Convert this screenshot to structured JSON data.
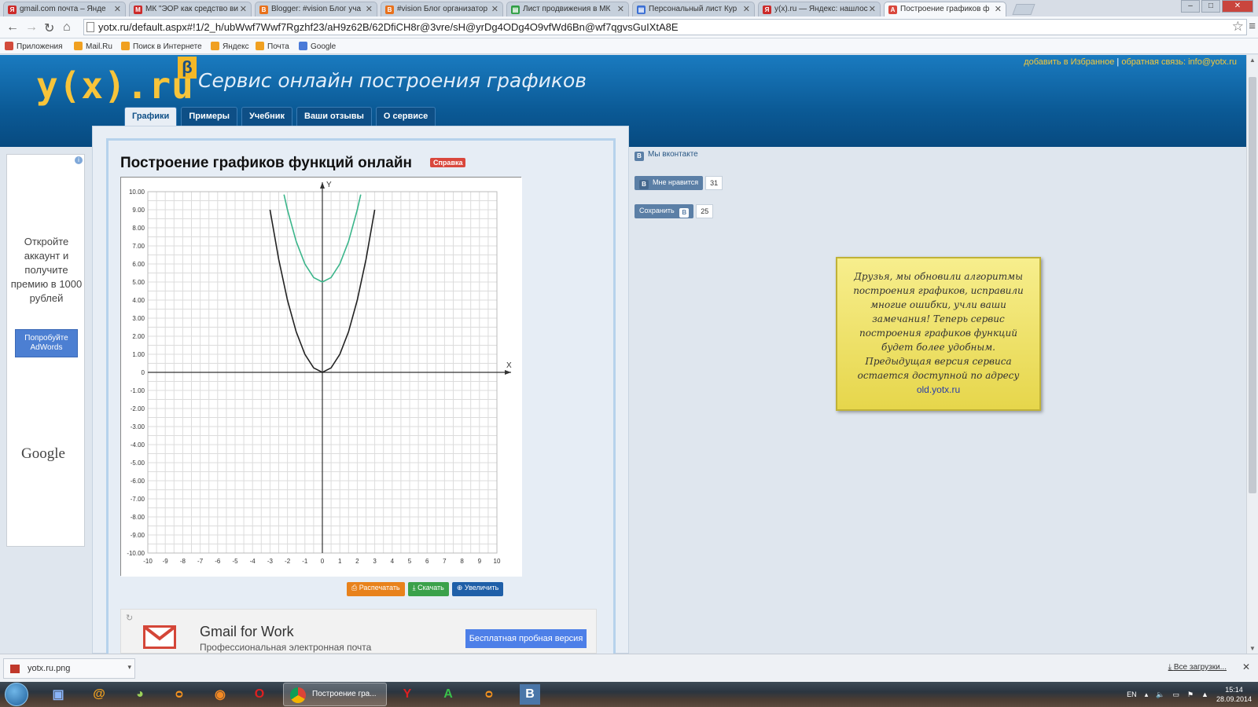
{
  "browser": {
    "tabs": [
      {
        "title": "gmail.com почта – Янде",
        "icon_color": "#cc2a2a",
        "icon": "Я"
      },
      {
        "title": "МК \"ЭОР как средство ви",
        "icon_color": "#cc2a2a",
        "icon": "M"
      },
      {
        "title": "Blogger: #vision Блог уча",
        "icon_color": "#e8711c",
        "icon": "B"
      },
      {
        "title": "#vision Блог организатор",
        "icon_color": "#e8711c",
        "icon": "B"
      },
      {
        "title": "Лист продвижения в МК",
        "icon_color": "#2f9e44",
        "icon": "▤"
      },
      {
        "title": "Персональный лист Кур",
        "icon_color": "#3b6fd4",
        "icon": "▤"
      },
      {
        "title": "y(x).ru — Яндекс: нашлос",
        "icon_color": "#cc2a2a",
        "icon": "Я"
      },
      {
        "title": "Построение графиков ф",
        "icon_color": "#d9473c",
        "icon": "A"
      }
    ],
    "url": "yotx.ru/default.aspx#!1/2_h/ubWwf7Wwf7Rgzhf23/aH9z62B/62DfiCH8r@3vre/sH@yrDg4ODg4O9vfWd6Bn@wf7qgvsGuIXtA8E",
    "bookmarks": [
      {
        "label": "Приложения",
        "color": "#d24b3c"
      },
      {
        "label": "Mail.Ru",
        "color": "#f0a020"
      },
      {
        "label": "Поиск в Интернете",
        "color": "#f0a020"
      },
      {
        "label": "Яндекс",
        "color": "#f0a020"
      },
      {
        "label": "Почта",
        "color": "#f0a020"
      },
      {
        "label": "Google",
        "color": "#4a7ad8"
      }
    ]
  },
  "site": {
    "logo": "y(x).ru",
    "beta": "β",
    "title": "Сервис онлайн построения графиков",
    "toplinks": {
      "favorites": "добавить в Избранное",
      "sep": " | ",
      "feedback": "обратная связь: info@yotx.ru"
    },
    "nav": [
      "Графики",
      "Примеры",
      "Учебник",
      "Ваши отзывы",
      "О сервисе"
    ],
    "heading": "Построение графиков функций онлайн",
    "help_badge": "Справка",
    "actions": [
      {
        "label": "⎙ Распечатать",
        "color": "#e8821c"
      },
      {
        "label": "⤓ Скачать",
        "color": "#3aa14a"
      },
      {
        "label": "⊕ Увеличить",
        "color": "#1f5fa8"
      }
    ]
  },
  "chart_data": {
    "type": "line",
    "title": "",
    "xlabel": "X",
    "ylabel": "Y",
    "xlim": [
      -10,
      10
    ],
    "ylim": [
      -10,
      10
    ],
    "grid": true,
    "xticks": [
      "-10",
      "-9",
      "-8",
      "-7",
      "-6",
      "-5",
      "-4",
      "-3",
      "-2",
      "-1",
      "0",
      "1",
      "2",
      "3",
      "4",
      "5",
      "6",
      "7",
      "8",
      "9",
      "10"
    ],
    "yticks": [
      "10.00",
      "9.00",
      "8.00",
      "7.00",
      "6.00",
      "5.00",
      "4.00",
      "3.00",
      "2.00",
      "1.00",
      "0",
      "-1.00",
      "-2.00",
      "-3.00",
      "-4.00",
      "-5.00",
      "-6.00",
      "-7.00",
      "-8.00",
      "-9.00",
      "-10.00"
    ],
    "series": [
      {
        "color": "#222222",
        "points": [
          [
            -3,
            9
          ],
          [
            -2.5,
            6.25
          ],
          [
            -2,
            4
          ],
          [
            -1.5,
            2.25
          ],
          [
            -1,
            1
          ],
          [
            -0.5,
            0.25
          ],
          [
            0,
            0
          ],
          [
            0.5,
            0.25
          ],
          [
            1,
            1
          ],
          [
            1.5,
            2.25
          ],
          [
            2,
            4
          ],
          [
            2.5,
            6.25
          ],
          [
            3,
            9
          ]
        ]
      },
      {
        "color": "#3ab58a",
        "points": [
          [
            -2.2,
            9.84
          ],
          [
            -2,
            9
          ],
          [
            -1.5,
            7.25
          ],
          [
            -1,
            6
          ],
          [
            -0.5,
            5.25
          ],
          [
            0,
            5
          ],
          [
            0.5,
            5.25
          ],
          [
            1,
            6
          ],
          [
            1.5,
            7.25
          ],
          [
            2,
            9
          ],
          [
            2.2,
            9.84
          ]
        ]
      }
    ]
  },
  "ad": {
    "text": "Откройте аккаунт и получите премию в 1000 рублей",
    "button": "Попробуйте AdWords",
    "brand": "Google"
  },
  "gmail_ad": {
    "title": "Gmail for Work",
    "subtitle": "Профессиональная электронная почта",
    "button": "Бесплатная пробная версия"
  },
  "vk": {
    "group": "Мы вконтакте",
    "like": "Мне нравится",
    "like_count": "31",
    "save": "Сохранить",
    "save_count": "25",
    "icon": "В"
  },
  "note": {
    "text": "Друзья, мы обновили алгоритмы построения графиков, исправили многие ошибки, учли ваши замечания! Теперь сервис построения графиков функций будет более удобным. Предыдущая версия сервиса остается доступной по адресу",
    "link": "old.yotx.ru"
  },
  "downloads": {
    "file": "yotx.ru.png",
    "all": "Все загрузки..."
  },
  "taskbar": {
    "active": "Построение гра...",
    "lang": "EN",
    "time": "15:14",
    "date": "28.09.2014"
  }
}
